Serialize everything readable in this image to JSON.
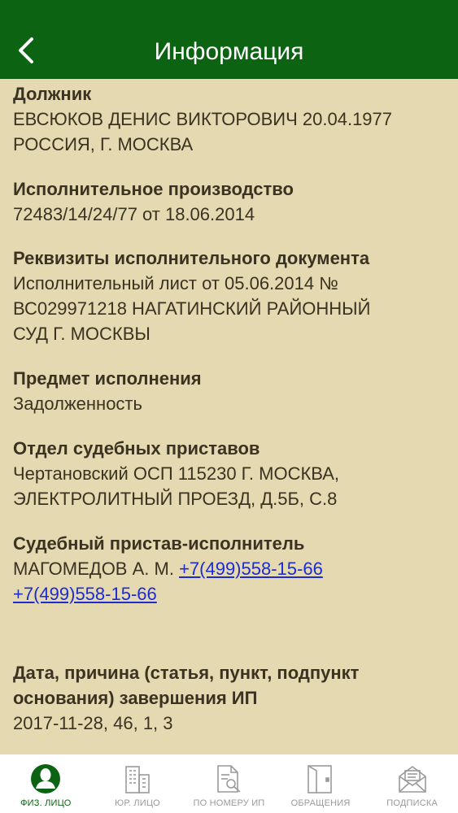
{
  "header": {
    "title": "Информация",
    "back_icon": "chevron-left-icon",
    "bg_color": "#0c6312"
  },
  "sections": {
    "debtor": {
      "label": "Должник",
      "lines": [
        "ЕВСЮКОВ ДЕНИС ВИКТОРОВИЧ 20.04.1977",
        "РОССИЯ, Г. МОСКВА"
      ]
    },
    "proceeding": {
      "label": "Исполнительное производство",
      "lines": [
        "72483/14/24/77 от 18.06.2014"
      ]
    },
    "document": {
      "label": "Реквизиты исполнительного документа",
      "lines": [
        "Исполнительный лист от 05.06.2014 №",
        "ВС029971218 НАГАТИНСКИЙ РАЙОННЫЙ",
        "СУД Г. МОСКВЫ"
      ]
    },
    "subject": {
      "label": "Предмет исполнения",
      "lines": [
        "Задолженность"
      ]
    },
    "department": {
      "label": "Отдел судебных приставов",
      "lines": [
        "Чертановский ОСП 115230 Г. МОСКВА,",
        "ЭЛЕКТРОЛИТНЫЙ ПРОЕЗД, Д.5Б, С.8"
      ]
    },
    "bailiff": {
      "label": "Судебный пристав-исполнитель",
      "name": "МАГОМЕДОВ А. М.",
      "phone_1": "+7(499)558-15-66",
      "phone_2": "+7(499)558-15-66"
    },
    "completion": {
      "label_line_1": "Дата, причина (статья, пункт, подпункт",
      "label_line_2": "основания) завершения ИП",
      "value": "2017-11-28, 46, 1, 3"
    }
  },
  "tabbar": {
    "tabs": [
      {
        "label": "ФИЗ. ЛИЦО",
        "icon": "person-icon",
        "active": true
      },
      {
        "label": "ЮР. ЛИЦО",
        "icon": "building-icon",
        "active": false
      },
      {
        "label": "ПО НОМЕРУ ИП",
        "icon": "document-search-icon",
        "active": false
      },
      {
        "label": "ОБРАЩЕНИЯ",
        "icon": "folder-icon",
        "active": false
      },
      {
        "label": "ПОДПИСКА",
        "icon": "envelope-icon",
        "active": false
      }
    ]
  }
}
